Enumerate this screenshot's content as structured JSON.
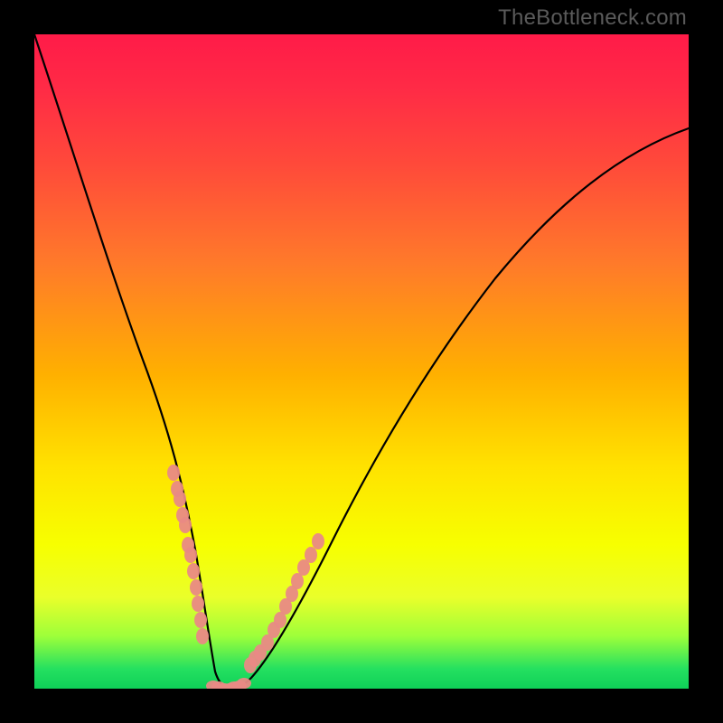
{
  "watermark": "TheBottleneck.com",
  "chart_data": {
    "type": "line",
    "title": "",
    "xlabel": "",
    "ylabel": "",
    "xlim": [
      0,
      100
    ],
    "ylim": [
      0,
      100
    ],
    "grid": false,
    "legend": false,
    "background_gradient": {
      "direction": "vertical",
      "stops": [
        {
          "pos": 0.0,
          "color": "#ff1b48"
        },
        {
          "pos": 0.35,
          "color": "#ff7a2a"
        },
        {
          "pos": 0.66,
          "color": "#ffe200"
        },
        {
          "pos": 0.92,
          "color": "#9dff3a"
        },
        {
          "pos": 1.0,
          "color": "#0fd058"
        }
      ]
    },
    "series": [
      {
        "name": "bottleneck-curve",
        "stroke": "#000000",
        "x": [
          0,
          3,
          6,
          9,
          12,
          15,
          18,
          20,
          22,
          24,
          25.5,
          27,
          29,
          31.5,
          35,
          40,
          46,
          53,
          61,
          70,
          80,
          90,
          100
        ],
        "y": [
          100,
          90,
          80,
          70,
          60,
          50,
          41,
          35,
          28,
          19,
          10,
          3,
          0,
          0,
          4,
          12,
          23,
          36,
          49,
          61,
          72,
          80,
          86
        ]
      },
      {
        "name": "left-dot-cluster",
        "type": "scatter",
        "color": "#e98a85",
        "x": [
          21.3,
          21.8,
          22.2,
          22.6,
          23.0,
          23.4,
          23.8,
          24.2,
          24.6,
          25.0,
          25.3,
          25.6
        ],
        "y": [
          33.0,
          30.5,
          29.0,
          26.5,
          25.0,
          22.0,
          20.5,
          18.0,
          15.5,
          13.0,
          10.5,
          8.0
        ]
      },
      {
        "name": "right-dot-cluster",
        "type": "scatter",
        "color": "#e98a85",
        "x": [
          33.0,
          33.7,
          34.5,
          35.7,
          36.6,
          37.5,
          38.4,
          39.3,
          40.2,
          41.1,
          42.3,
          43.3
        ],
        "y": [
          3.5,
          4.5,
          5.5,
          7.0,
          9.0,
          10.5,
          12.5,
          14.5,
          16.5,
          18.5,
          20.5,
          22.5
        ]
      },
      {
        "name": "valley-floor-cluster",
        "type": "scatter",
        "color": "#e98a85",
        "x": [
          27.4,
          28.2,
          29.0,
          29.8,
          30.6,
          31.3,
          32.0
        ],
        "y": [
          0.4,
          0.2,
          0.0,
          0.0,
          0.2,
          0.4,
          0.8
        ]
      }
    ]
  }
}
